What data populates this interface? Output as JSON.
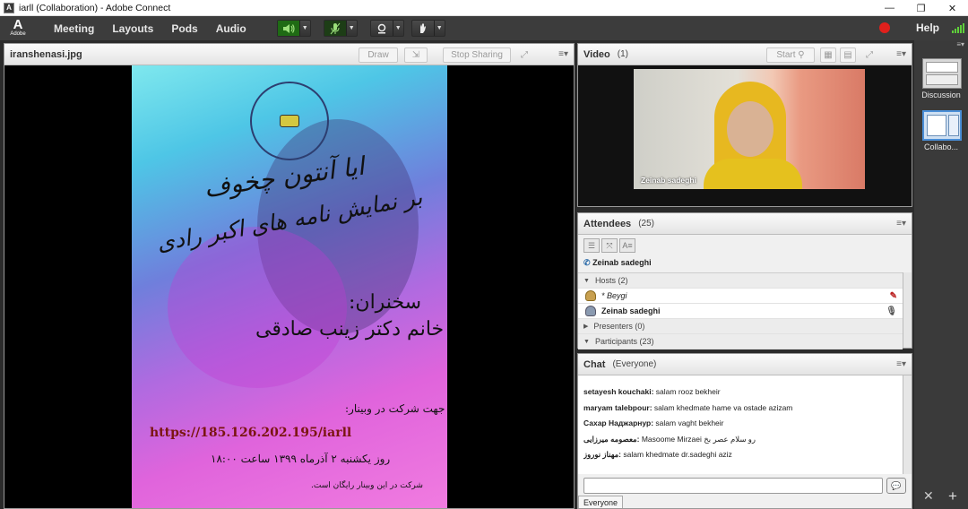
{
  "window": {
    "title": "iarll (Collaboration) - Adobe Connect",
    "app_icon": "A",
    "controls": [
      "—",
      "❐",
      "✕"
    ]
  },
  "menubar": {
    "logo": "Adobe",
    "items": [
      "Meeting",
      "Layouts",
      "Pods",
      "Audio"
    ],
    "help": "Help",
    "icons": [
      "speaker-icon",
      "microphone-icon",
      "webcam-icon",
      "raise-hand-icon",
      "record-icon",
      "connection-bars-icon"
    ]
  },
  "share_pod": {
    "title": "iranshenasi.jpg",
    "draw_label": "Draw",
    "stop_sharing_label": "Stop Sharing"
  },
  "poster": {
    "title_line_1": "ایا آنتون چخوف",
    "title_line_2": "بر نمایش نامه های اکبر رادی",
    "speaker_label": "سخنران:",
    "speaker_name": "خانم دکتر زینب صادقی",
    "join_label": "جهت شرکت در وبینار:",
    "url": "https://185.126.202.195/iarll",
    "datetime": "روز یکشنبه ۲ آذرماه ۱۳۹۹ ساعت ۱۸:۰۰",
    "free_note": "شرکت در این وبینار رایگان است."
  },
  "video_pod": {
    "title": "Video",
    "count": "(1)",
    "start_label": "Start",
    "feed_name": "Zeinab sadeghi"
  },
  "attendees_pod": {
    "title": "Attendees",
    "count": "(25)",
    "active_speaker": "Zeinab sadeghi",
    "groups": {
      "hosts": "Hosts (2)",
      "presenters": "Presenters (0)",
      "participants": "Participants (23)"
    },
    "hosts": [
      {
        "name": "* Beygi",
        "status_icon": "mic-muted-icon"
      },
      {
        "name": "Zeinab sadeghi",
        "status_icon": "mic-active-icon"
      }
    ]
  },
  "chat_pod": {
    "title": "Chat",
    "scope": "(Everyone)",
    "messages": [
      {
        "sender": "setayesh kouchaki:",
        "text": " salam rooz bekheir"
      },
      {
        "sender": "maryam talebpour:",
        "text": " salam khedmate hame va ostade azizam"
      },
      {
        "sender": "Сахар Наджарнур:",
        "text": " salam vaght bekheir"
      },
      {
        "sender": "معصومه میرزایی:",
        "text": " Masoome Mirzaei رو سلام عصر بخ"
      },
      {
        "sender": "مهناز نوروز:",
        "text": " salam khedmate dr.sadeghi aziz"
      }
    ],
    "input_placeholder": "",
    "tab_label": "Everyone"
  },
  "layout_strip": {
    "items": [
      "Discussion",
      "Collabo..."
    ]
  },
  "colors": {
    "menubar_bg": "#3c3c3c",
    "pod_header": "#e4e4e4",
    "record": "#e0201c",
    "audio_active": "#1f6b14",
    "signal": "#5fcf3a"
  }
}
